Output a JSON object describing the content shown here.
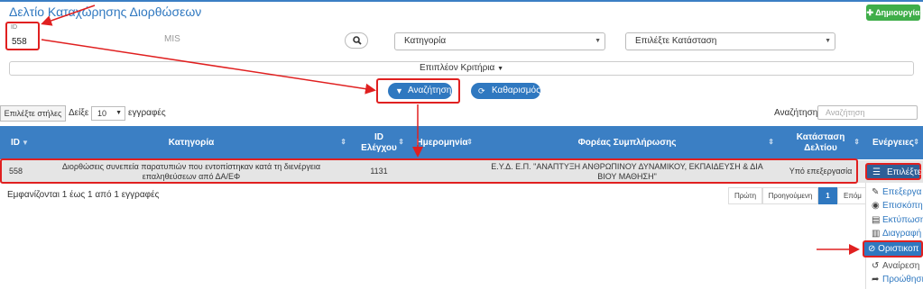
{
  "header": {
    "title": "Δελτίο Καταχώρησης Διορθώσεων",
    "create_button": "Δημιουργία"
  },
  "filters": {
    "id_label": "ID",
    "id_value": "558",
    "mis_placeholder": "MIS",
    "category_value": "Κατηγορία",
    "status_value": "Επιλέξτε Κατάσταση",
    "more_criteria": "Επιπλέον Κριτήρια",
    "search_button": "Αναζήτηση",
    "clear_button": "Καθαρισμός"
  },
  "table_controls": {
    "choose_columns": "Επιλέξτε στήλες",
    "show_label": "Δείξε",
    "page_size": "10",
    "records_label": "εγγραφές",
    "search_label": "Αναζήτηση:",
    "search_placeholder": "Αναζήτηση"
  },
  "table": {
    "columns": [
      "ID",
      "Κατηγορία",
      "ID Ελέγχου",
      "Ημερομηνία",
      "Φορέας Συμπλήρωσης",
      "Κατάσταση Δελτίου",
      "Ενέργειες"
    ],
    "rows": [
      {
        "id": "558",
        "category": "Διορθώσεις συνεπεία παρατυπιών που εντοπίστηκαν κατά τη διενέργεια επαληθεύσεων από ΔΑ/ΕΦ",
        "control_id": "1131",
        "date": "",
        "agency": "Ε.Υ.Δ. Ε.Π. \"ΑΝΑΠΤΥΞΗ ΑΝΘΡΩΠΙΝΟΥ ΔΥΝΑΜΙΚΟΥ, ΕΚΠΑΙΔΕΥΣΗ & ΔΙΑ ΒΙΟΥ ΜΑΘΗΣΗ\"",
        "status": "Υπό επεξεργασία",
        "action": "Επιλέξτε"
      }
    ],
    "info": "Εμφανίζονται 1 έως 1 από 1 εγγραφές"
  },
  "pagination": {
    "first": "Πρώτη",
    "prev": "Προηγούμενη",
    "current": "1",
    "next": "Επόμ"
  },
  "action_menu": {
    "edit": "Επεξεργα",
    "view": "Επισκόπη",
    "print": "Εκτύπωση",
    "delete": "Διαγραφή",
    "finalize": "Οριστικοπ",
    "revert": "Αναίρεση",
    "forward": "Προώθηση"
  },
  "colors": {
    "accent": "#2f78c0",
    "header": "#3b7fc4",
    "create": "#3fae49",
    "annotation": "#e02020"
  }
}
